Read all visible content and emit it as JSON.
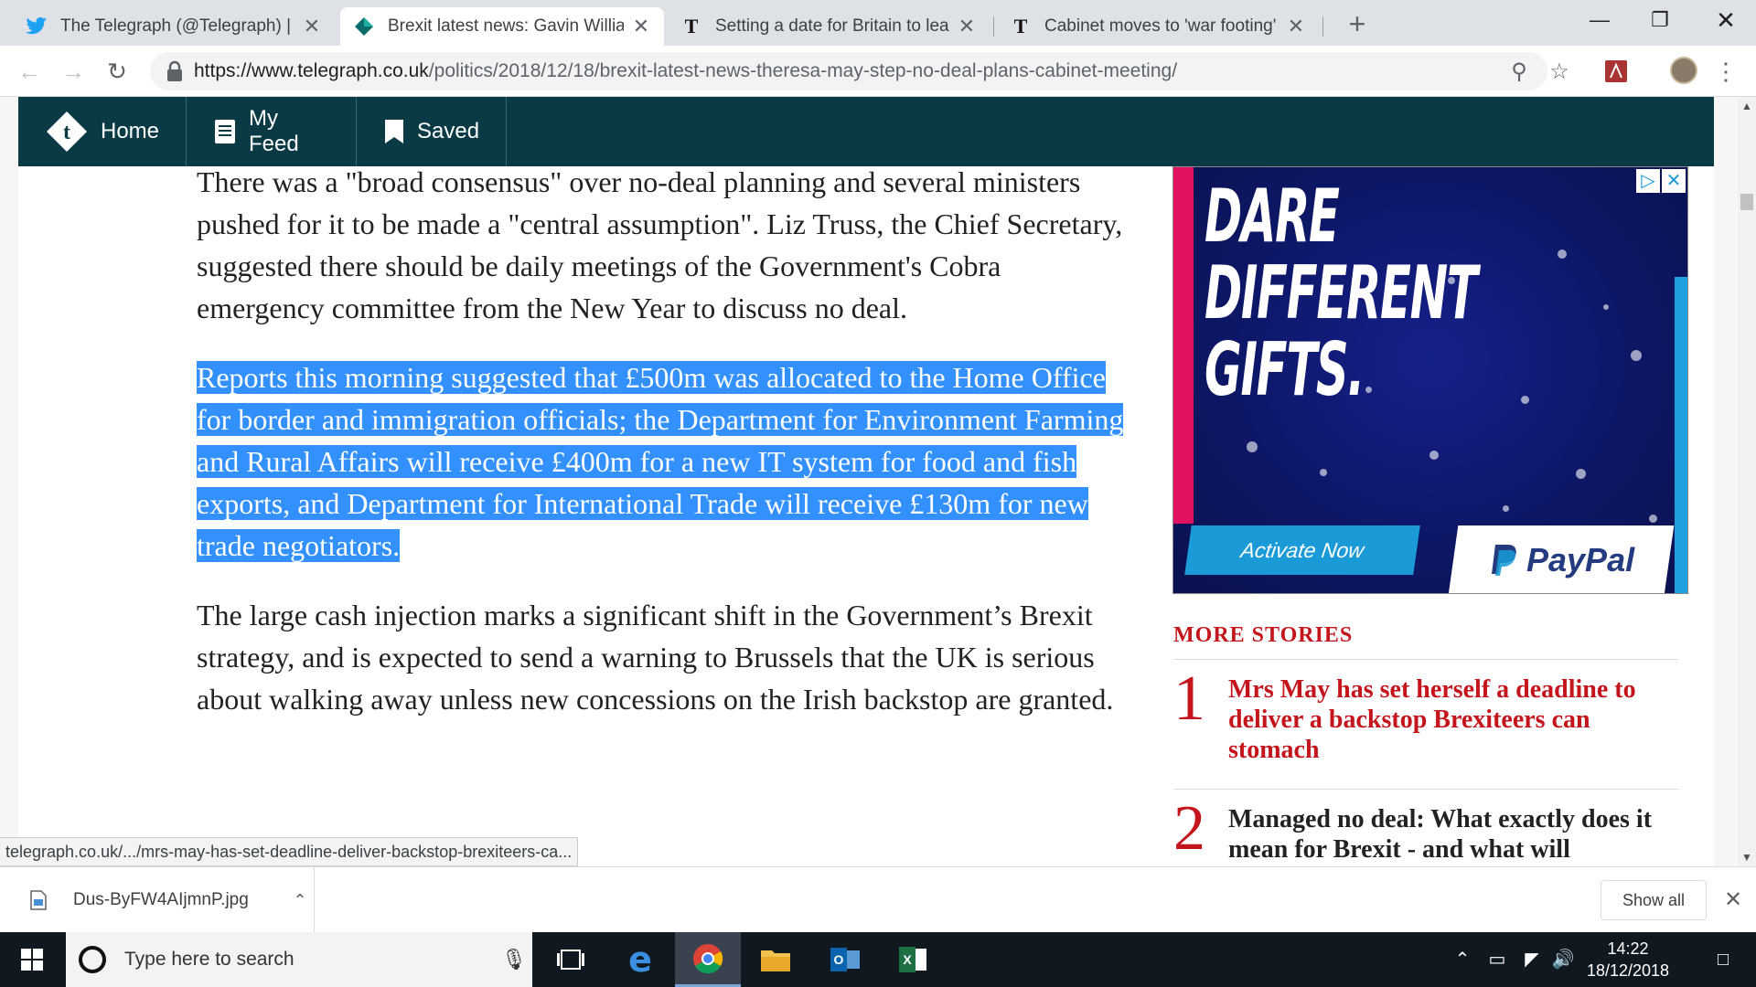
{
  "browser": {
    "tabs": [
      {
        "title": "The Telegraph (@Telegraph) | Twi",
        "icon": "twitter-icon",
        "active": false
      },
      {
        "title": "Brexit latest news: Gavin Williams",
        "icon": "telegraph-diamond-icon",
        "active": true
      },
      {
        "title": "Setting a date for Britain to leave",
        "icon": "telegraph-t-icon",
        "active": false
      },
      {
        "title": "Cabinet moves to 'war footing' fo",
        "icon": "telegraph-t-icon",
        "active": false
      }
    ],
    "url_host": "https://www.telegraph.co.uk",
    "url_path": "/politics/2018/12/18/brexit-latest-news-theresa-may-step-no-deal-plans-cabinet-meeting/"
  },
  "site_nav": {
    "home": "Home",
    "my_feed": "My Feed",
    "saved": "Saved"
  },
  "article": {
    "p1": "There was a \"broad consensus\" over no-deal planning and several ministers pushed for it to be made a \"central assumption\". Liz Truss, the Chief Secretary, suggested there should be daily meetings of the Government's Cobra emergency committee from the New Year to discuss no deal.",
    "p2_selected": "Reports this morning suggested that £500m was allocated to the Home Office for border and immigration officials; the Department for Environment Farming and Rural Affairs will receive £400m for a new IT system for food and fish exports, and Department for International Trade will receive £130m for new trade negotiators.",
    "p3": "The large cash injection marks a significant shift in the Government’s Brexit strategy, and is expected to send a warning to Brussels that the UK is serious about walking away unless new concessions on the Irish backstop are granted."
  },
  "ad": {
    "line1": "DARE",
    "line2": "DIFFERENT",
    "line3": "GIFTS.",
    "cta": "Activate Now",
    "brand": "PayPal"
  },
  "more_stories": {
    "heading": "MORE STORIES",
    "items": [
      {
        "num": "1",
        "headline": "Mrs May has set herself a deadline to deliver a backstop Brexiteers can stomach"
      },
      {
        "num": "2",
        "headline": "Managed no deal: What exactly does it mean for Brexit - and what will"
      }
    ]
  },
  "status_url": "telegraph.co.uk/.../mrs-may-has-set-deadline-deliver-backstop-brexiteers-ca...",
  "downloads": {
    "filename": "Dus-ByFW4AIjmnP.jpg",
    "show_all": "Show all"
  },
  "taskbar": {
    "search_placeholder": "Type here to search",
    "time": "14:22",
    "date": "18/12/2018"
  },
  "colors": {
    "telegraph_nav": "#0a3a44",
    "story_red": "#c4151c",
    "selection": "#3390ff"
  }
}
